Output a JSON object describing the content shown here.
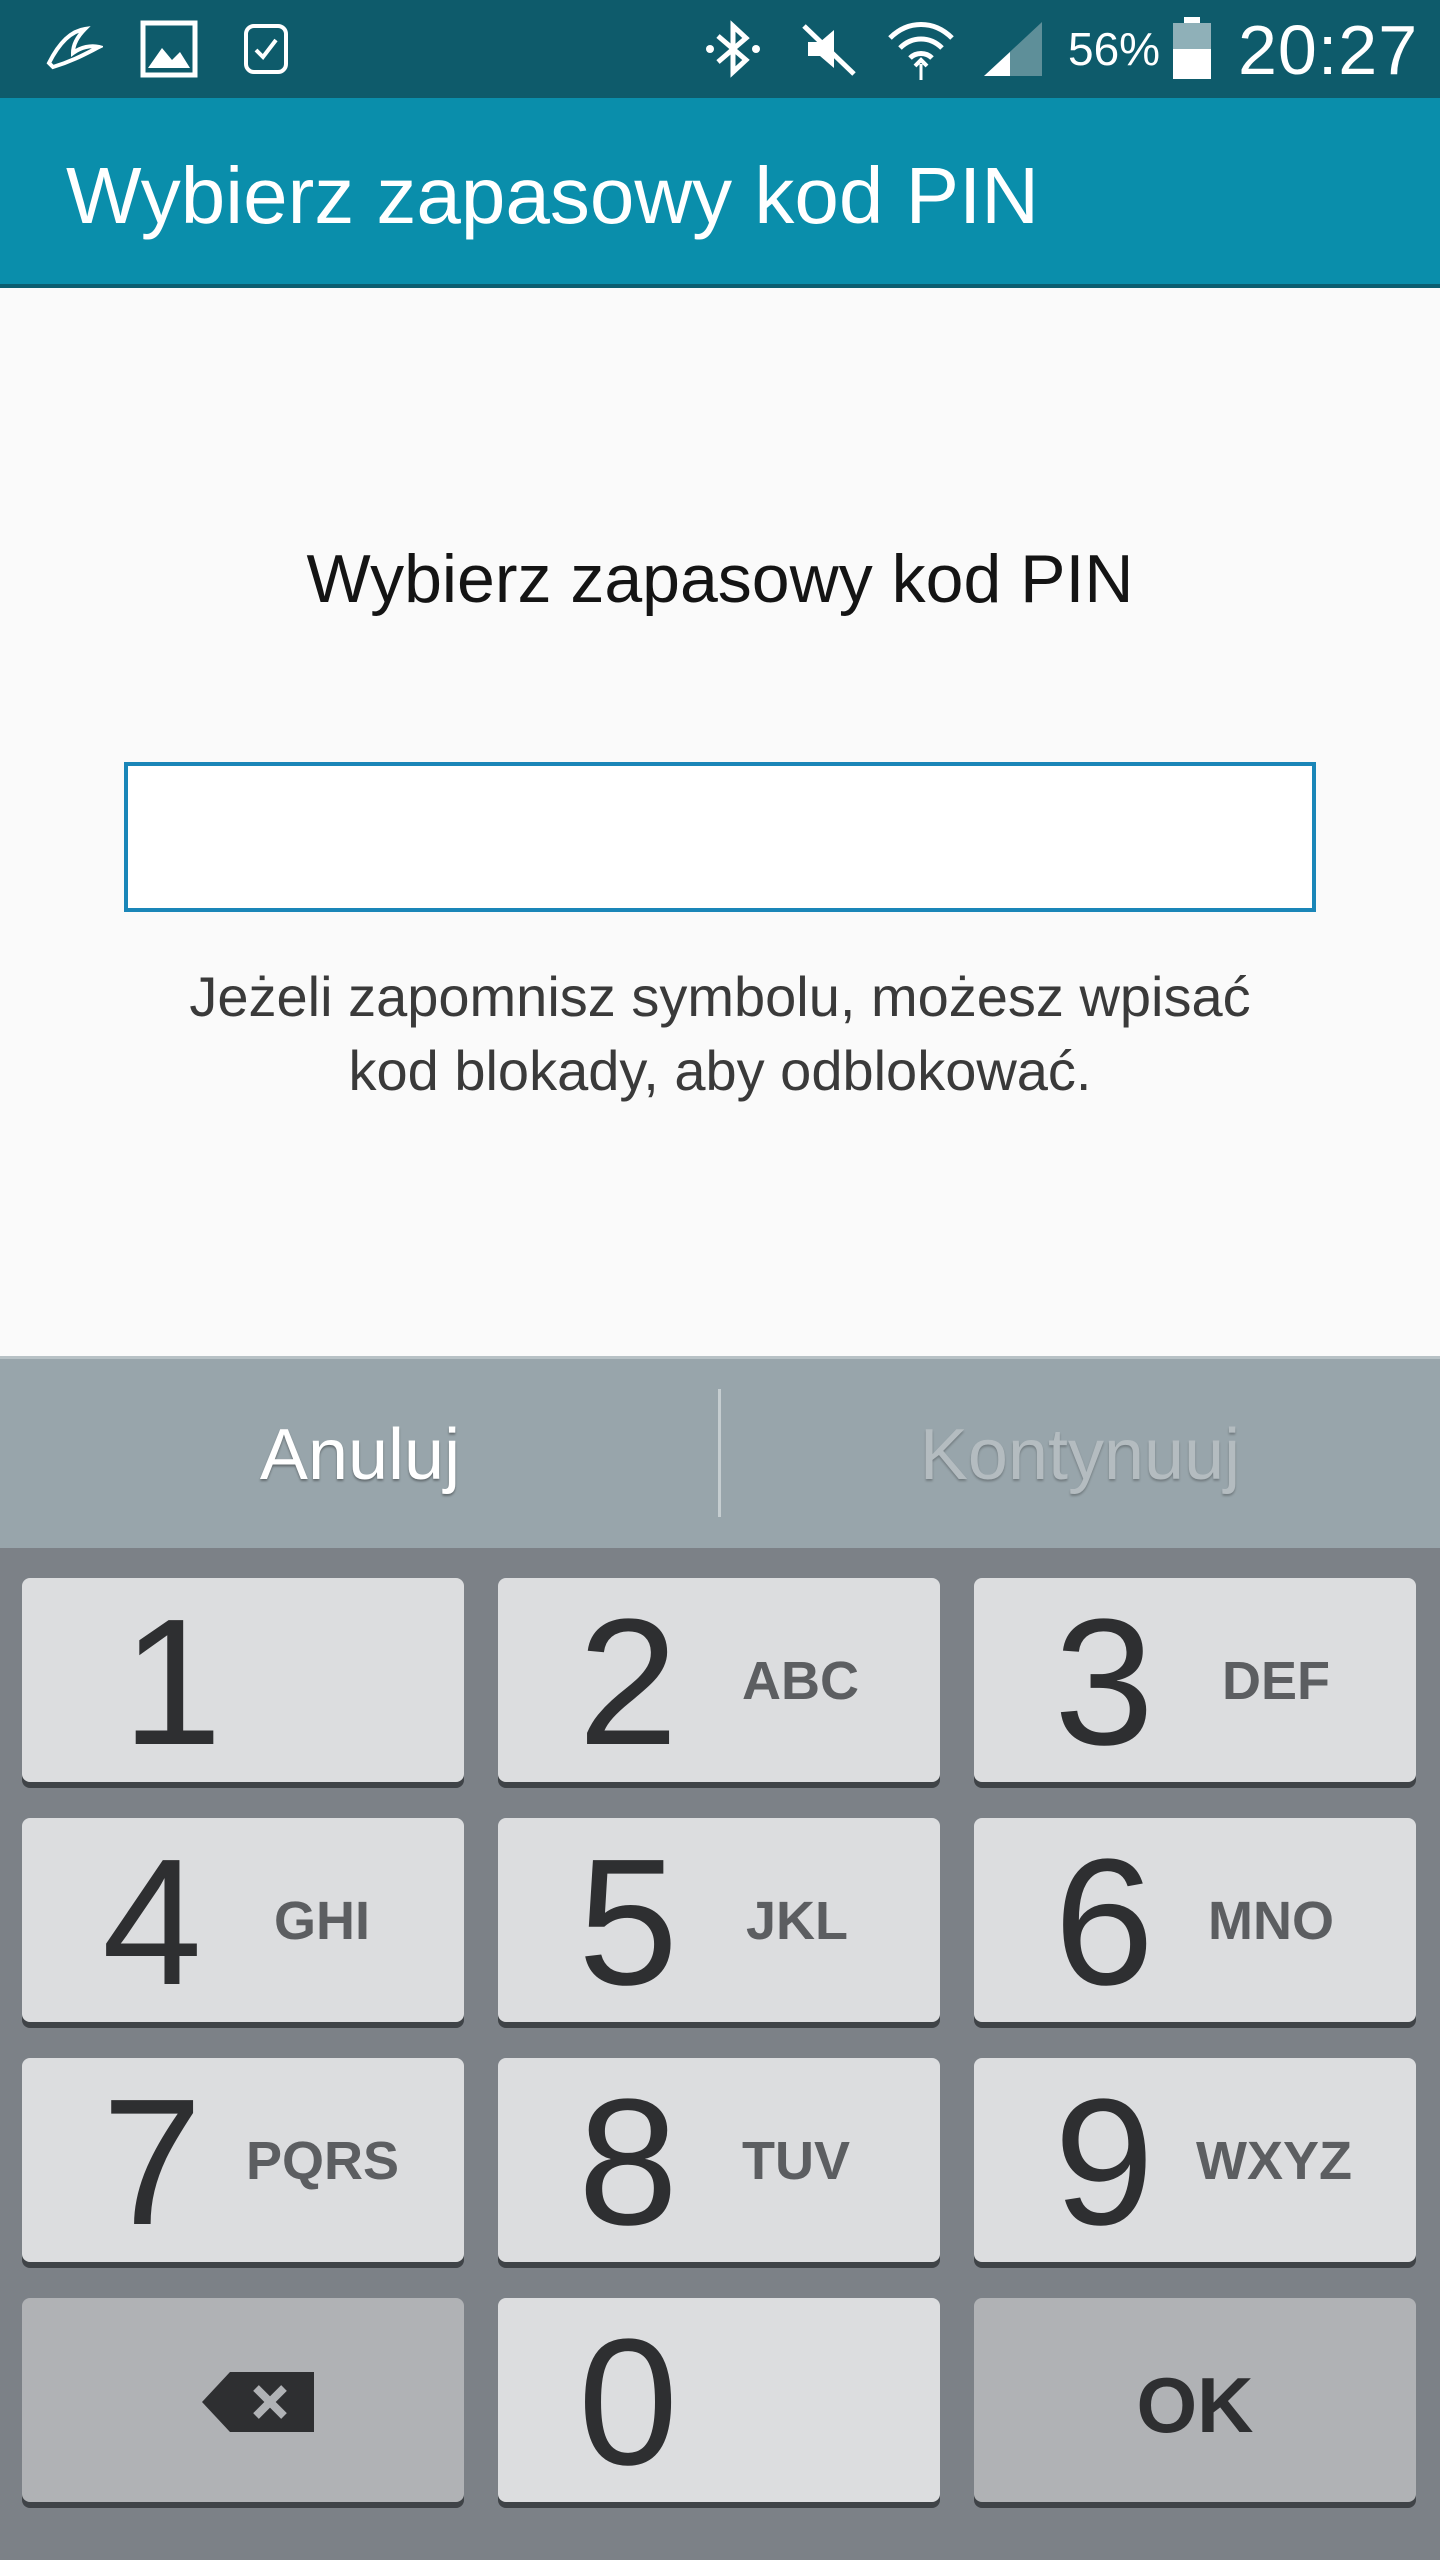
{
  "status_bar": {
    "battery_percent": "56%",
    "time": "20:27",
    "icons": [
      "swiftkey-icon",
      "image-icon",
      "watch-icon",
      "bluetooth-icon",
      "mute-icon",
      "wifi-icon",
      "signal-icon",
      "battery-icon"
    ]
  },
  "action_bar": {
    "title": "Wybierz zapasowy kod PIN"
  },
  "content": {
    "heading": "Wybierz zapasowy kod PIN",
    "pin_value": "",
    "hint_line1": "Jeżeli zapomnisz symbolu, możesz wpisać",
    "hint_line2": "kod blokady, aby odblokować."
  },
  "buttons": {
    "cancel": "Anuluj",
    "continue": "Kontynuuj"
  },
  "keypad": {
    "keys": [
      {
        "num": "1",
        "letters": ""
      },
      {
        "num": "2",
        "letters": "ABC"
      },
      {
        "num": "3",
        "letters": "DEF"
      },
      {
        "num": "4",
        "letters": "GHI"
      },
      {
        "num": "5",
        "letters": "JKL"
      },
      {
        "num": "6",
        "letters": "MNO"
      },
      {
        "num": "7",
        "letters": "PQRS"
      },
      {
        "num": "8",
        "letters": "TUV"
      },
      {
        "num": "9",
        "letters": "WXYZ"
      },
      {
        "num": "0",
        "letters": ""
      }
    ],
    "ok": "OK"
  },
  "colors": {
    "status_bar": "#0e5b6b",
    "action_bar": "#0a8eab",
    "field_border": "#1a86b8",
    "button_row": "#98a5ab",
    "keypad_bg": "#7c8187"
  }
}
